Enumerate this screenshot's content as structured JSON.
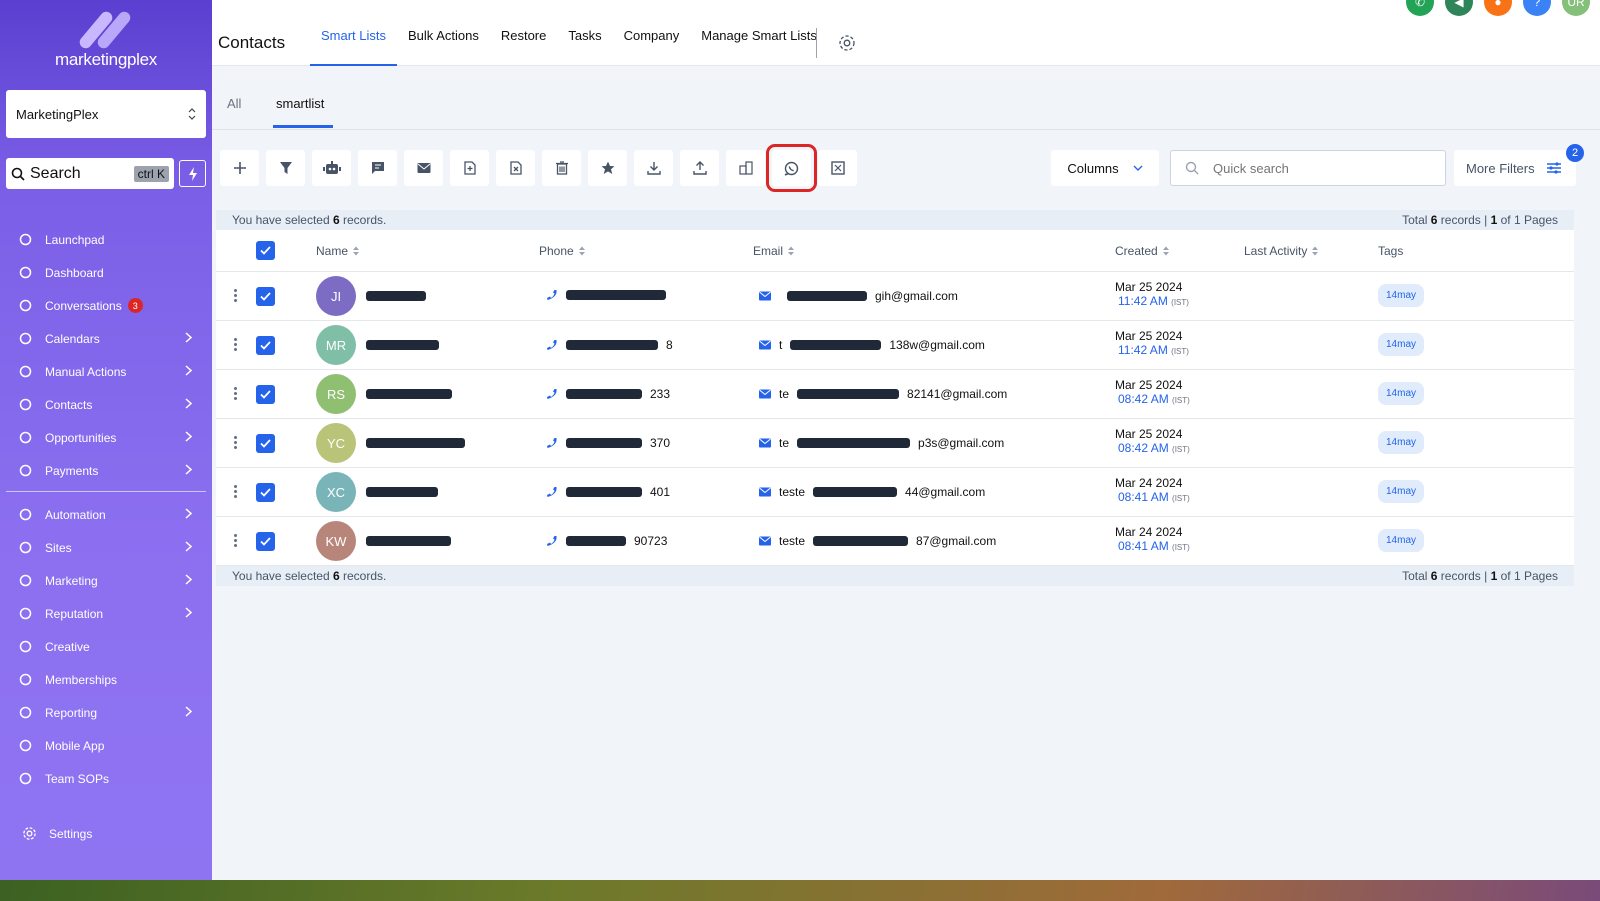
{
  "sidebar": {
    "brand": "marketingplex",
    "account": "MarketingPlex",
    "search_label": "Search",
    "search_shortcut": "ctrl K",
    "items": [
      {
        "label": "Launchpad",
        "icon": "rocket-icon",
        "chevron": false
      },
      {
        "label": "Dashboard",
        "icon": "dashboard-icon",
        "chevron": false
      },
      {
        "label": "Conversations",
        "icon": "chat-icon",
        "chevron": false,
        "badge": "3"
      },
      {
        "label": "Calendars",
        "icon": "calendar-icon",
        "chevron": true
      },
      {
        "label": "Manual Actions",
        "icon": "check-circle-icon",
        "chevron": true
      },
      {
        "label": "Contacts",
        "icon": "contacts-icon",
        "chevron": true
      },
      {
        "label": "Opportunities",
        "icon": "funnel-icon",
        "chevron": true
      },
      {
        "label": "Payments",
        "icon": "card-icon",
        "chevron": true
      }
    ],
    "items2": [
      {
        "label": "Automation",
        "icon": "wand-icon",
        "chevron": true
      },
      {
        "label": "Sites",
        "icon": "globe-icon",
        "chevron": true
      },
      {
        "label": "Marketing",
        "icon": "megaphone-icon",
        "chevron": true
      },
      {
        "label": "Reputation",
        "icon": "star-icon",
        "chevron": true
      },
      {
        "label": "Creative",
        "icon": "palette-icon",
        "chevron": false
      },
      {
        "label": "Memberships",
        "icon": "badge-icon",
        "chevron": false
      },
      {
        "label": "Reporting",
        "icon": "chart-icon",
        "chevron": true
      },
      {
        "label": "Mobile App",
        "icon": "phone-icon",
        "chevron": false
      },
      {
        "label": "Team SOPs",
        "icon": "list-icon",
        "chevron": false
      }
    ],
    "settings": "Settings"
  },
  "header": {
    "title": "Contacts",
    "tabs": [
      "Smart Lists",
      "Bulk Actions",
      "Restore",
      "Tasks",
      "Company",
      "Manage Smart Lists"
    ],
    "active_tab": "Smart Lists",
    "avatar_initials": "UR"
  },
  "subtabs": {
    "all": "All",
    "smartlist": "smartlist"
  },
  "toolbar": {
    "columns": "Columns",
    "search_placeholder": "Quick search",
    "more_filters": "More Filters",
    "filter_count": "2"
  },
  "selection": {
    "text_pre": "You have selected ",
    "count": "6",
    "text_post": " records.",
    "total_pre": "Total ",
    "total": "6",
    "total_mid": " records | ",
    "page": "1",
    "page_mid": " of ",
    "pages": "1",
    "page_post": " Pages"
  },
  "table": {
    "headers": {
      "name": "Name",
      "phone": "Phone",
      "email": "Email",
      "created": "Created",
      "last_activity": "Last Activity",
      "tags": "Tags"
    },
    "rows": [
      {
        "initials": "JI",
        "avatar_color": "#7c6cc4",
        "phone_tail": "",
        "email_tail": "gih@gmail.com",
        "email_prefix": "",
        "date": "Mar 25 2024",
        "time": "11:42 AM",
        "tz": "(IST)",
        "tag": "14may"
      },
      {
        "initials": "MR",
        "avatar_color": "#7fbfa8",
        "phone_tail": "8",
        "email_tail": "138w@gmail.com",
        "email_prefix": "t",
        "date": "Mar 25 2024",
        "time": "11:42 AM",
        "tz": "(IST)",
        "tag": "14may"
      },
      {
        "initials": "RS",
        "avatar_color": "#8fbf70",
        "phone_tail": "233",
        "email_tail": "82141@gmail.com",
        "email_prefix": "te",
        "date": "Mar 25 2024",
        "time": "08:42 AM",
        "tz": "(IST)",
        "tag": "14may"
      },
      {
        "initials": "YC",
        "avatar_color": "#b9c478",
        "phone_tail": "370",
        "email_tail": "p3s@gmail.com",
        "email_prefix": "te",
        "date": "Mar 25 2024",
        "time": "08:42 AM",
        "tz": "(IST)",
        "tag": "14may"
      },
      {
        "initials": "XC",
        "avatar_color": "#78b4b8",
        "phone_tail": "401",
        "email_tail": "44@gmail.com",
        "email_prefix": "teste",
        "date": "Mar 24 2024",
        "time": "08:41 AM",
        "tz": "(IST)",
        "tag": "14may"
      },
      {
        "initials": "KW",
        "avatar_color": "#b8857a",
        "phone_tail": "90723",
        "email_tail": "87@gmail.com",
        "email_prefix": "teste",
        "date": "Mar 24 2024",
        "time": "08:41 AM",
        "tz": "(IST)",
        "tag": "14may"
      }
    ]
  },
  "colors": {
    "accent": "#2563eb",
    "sidebar": "#7a5ee6",
    "highlight": "#dc2626"
  }
}
